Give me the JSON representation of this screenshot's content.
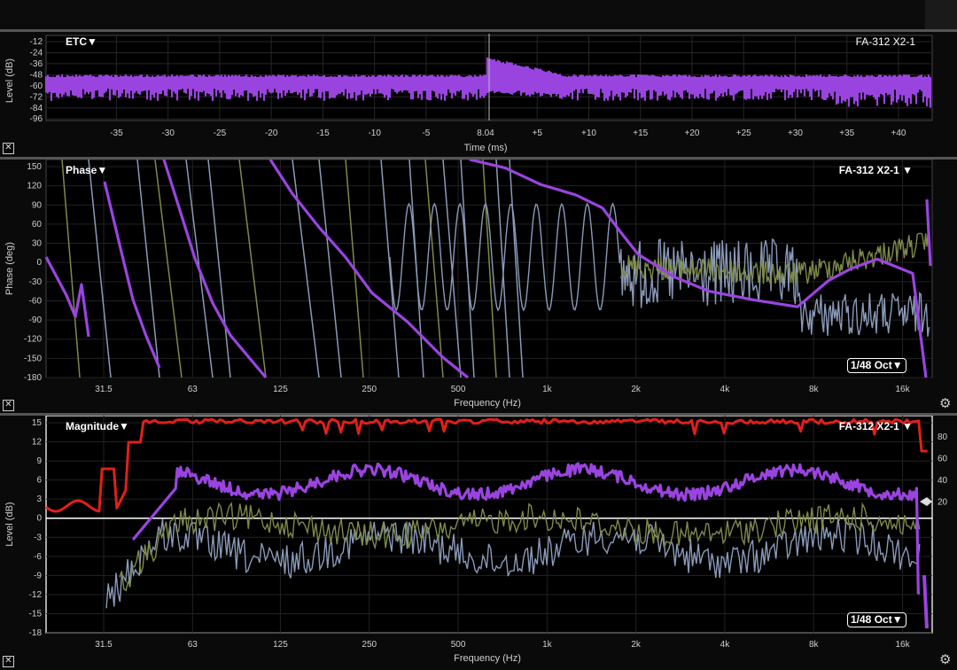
{
  "etc": {
    "title": "ETC▼",
    "source": "FA-312 X2-1",
    "ylabel": "Level (dB)",
    "xlabel": "Time (ms)",
    "yticks": [
      "-12",
      "-24",
      "-36",
      "-48",
      "-60",
      "-72",
      "-84",
      "-96"
    ],
    "xticks": [
      "-35",
      "-30",
      "-25",
      "-20",
      "-15",
      "-10",
      "-5",
      "8.04",
      "+5",
      "+10",
      "+15",
      "+20",
      "+25",
      "+30",
      "+35",
      "+40"
    ],
    "close_icon": "close-icon"
  },
  "phase": {
    "title": "Phase▼",
    "source": "FA-312 X2-1 ▼",
    "ylabel": "Phase (deg)",
    "xlabel": "Frequency (Hz)",
    "yticks": [
      "150",
      "120",
      "90",
      "60",
      "30",
      "0",
      "-30",
      "-60",
      "-90",
      "-120",
      "-150",
      "-180"
    ],
    "xticks": [
      "31.5",
      "63",
      "125",
      "250",
      "500",
      "1k",
      "2k",
      "4k",
      "8k",
      "16k"
    ],
    "smoothing": "1/48 Oct▼",
    "close_icon": "close-icon",
    "settings_icon": "gear-icon"
  },
  "magnitude": {
    "title": "Magnitude▼",
    "source": "FA-312 X2-1 ▼",
    "ylabel": "Level (dB)",
    "xlabel": "Frequency (Hz)",
    "yticks": [
      "15",
      "12",
      "9",
      "6",
      "3",
      "0",
      "-3",
      "-6",
      "-9",
      "-12",
      "-15",
      "-18"
    ],
    "coherence_ticks": [
      "80",
      "60",
      "40",
      "20"
    ],
    "xticks": [
      "31.5",
      "63",
      "125",
      "250",
      "500",
      "1k",
      "2k",
      "4k",
      "8k",
      "16k"
    ],
    "smoothing": "1/48 Oct▼",
    "close_icon": "close-icon",
    "settings_icon": "gear-icon"
  },
  "colors": {
    "primary_trace": "#9a44e0",
    "coherence_trace": "#e0201a",
    "reference_trace_a": "#8a9ab8",
    "reference_trace_b": "#7e8a4a",
    "zero_line": "#ffffff"
  }
}
